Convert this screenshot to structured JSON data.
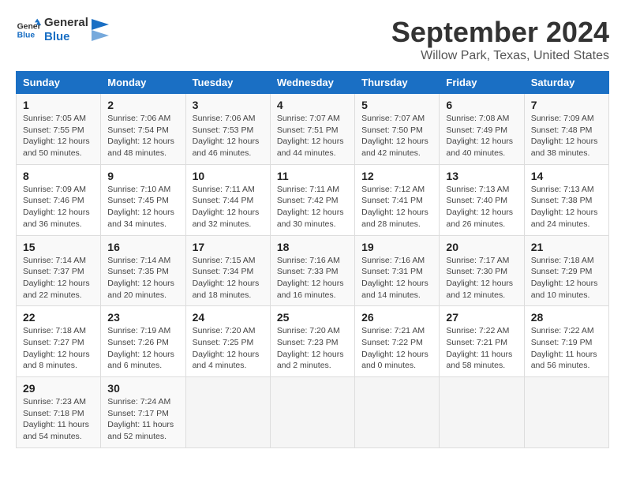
{
  "logo": {
    "line1": "General",
    "line2": "Blue"
  },
  "title": "September 2024",
  "subtitle": "Willow Park, Texas, United States",
  "headers": [
    "Sunday",
    "Monday",
    "Tuesday",
    "Wednesday",
    "Thursday",
    "Friday",
    "Saturday"
  ],
  "weeks": [
    [
      {
        "day": "1",
        "sunrise": "Sunrise: 7:05 AM",
        "sunset": "Sunset: 7:55 PM",
        "daylight": "Daylight: 12 hours and 50 minutes."
      },
      {
        "day": "2",
        "sunrise": "Sunrise: 7:06 AM",
        "sunset": "Sunset: 7:54 PM",
        "daylight": "Daylight: 12 hours and 48 minutes."
      },
      {
        "day": "3",
        "sunrise": "Sunrise: 7:06 AM",
        "sunset": "Sunset: 7:53 PM",
        "daylight": "Daylight: 12 hours and 46 minutes."
      },
      {
        "day": "4",
        "sunrise": "Sunrise: 7:07 AM",
        "sunset": "Sunset: 7:51 PM",
        "daylight": "Daylight: 12 hours and 44 minutes."
      },
      {
        "day": "5",
        "sunrise": "Sunrise: 7:07 AM",
        "sunset": "Sunset: 7:50 PM",
        "daylight": "Daylight: 12 hours and 42 minutes."
      },
      {
        "day": "6",
        "sunrise": "Sunrise: 7:08 AM",
        "sunset": "Sunset: 7:49 PM",
        "daylight": "Daylight: 12 hours and 40 minutes."
      },
      {
        "day": "7",
        "sunrise": "Sunrise: 7:09 AM",
        "sunset": "Sunset: 7:48 PM",
        "daylight": "Daylight: 12 hours and 38 minutes."
      }
    ],
    [
      {
        "day": "8",
        "sunrise": "Sunrise: 7:09 AM",
        "sunset": "Sunset: 7:46 PM",
        "daylight": "Daylight: 12 hours and 36 minutes."
      },
      {
        "day": "9",
        "sunrise": "Sunrise: 7:10 AM",
        "sunset": "Sunset: 7:45 PM",
        "daylight": "Daylight: 12 hours and 34 minutes."
      },
      {
        "day": "10",
        "sunrise": "Sunrise: 7:11 AM",
        "sunset": "Sunset: 7:44 PM",
        "daylight": "Daylight: 12 hours and 32 minutes."
      },
      {
        "day": "11",
        "sunrise": "Sunrise: 7:11 AM",
        "sunset": "Sunset: 7:42 PM",
        "daylight": "Daylight: 12 hours and 30 minutes."
      },
      {
        "day": "12",
        "sunrise": "Sunrise: 7:12 AM",
        "sunset": "Sunset: 7:41 PM",
        "daylight": "Daylight: 12 hours and 28 minutes."
      },
      {
        "day": "13",
        "sunrise": "Sunrise: 7:13 AM",
        "sunset": "Sunset: 7:40 PM",
        "daylight": "Daylight: 12 hours and 26 minutes."
      },
      {
        "day": "14",
        "sunrise": "Sunrise: 7:13 AM",
        "sunset": "Sunset: 7:38 PM",
        "daylight": "Daylight: 12 hours and 24 minutes."
      }
    ],
    [
      {
        "day": "15",
        "sunrise": "Sunrise: 7:14 AM",
        "sunset": "Sunset: 7:37 PM",
        "daylight": "Daylight: 12 hours and 22 minutes."
      },
      {
        "day": "16",
        "sunrise": "Sunrise: 7:14 AM",
        "sunset": "Sunset: 7:35 PM",
        "daylight": "Daylight: 12 hours and 20 minutes."
      },
      {
        "day": "17",
        "sunrise": "Sunrise: 7:15 AM",
        "sunset": "Sunset: 7:34 PM",
        "daylight": "Daylight: 12 hours and 18 minutes."
      },
      {
        "day": "18",
        "sunrise": "Sunrise: 7:16 AM",
        "sunset": "Sunset: 7:33 PM",
        "daylight": "Daylight: 12 hours and 16 minutes."
      },
      {
        "day": "19",
        "sunrise": "Sunrise: 7:16 AM",
        "sunset": "Sunset: 7:31 PM",
        "daylight": "Daylight: 12 hours and 14 minutes."
      },
      {
        "day": "20",
        "sunrise": "Sunrise: 7:17 AM",
        "sunset": "Sunset: 7:30 PM",
        "daylight": "Daylight: 12 hours and 12 minutes."
      },
      {
        "day": "21",
        "sunrise": "Sunrise: 7:18 AM",
        "sunset": "Sunset: 7:29 PM",
        "daylight": "Daylight: 12 hours and 10 minutes."
      }
    ],
    [
      {
        "day": "22",
        "sunrise": "Sunrise: 7:18 AM",
        "sunset": "Sunset: 7:27 PM",
        "daylight": "Daylight: 12 hours and 8 minutes."
      },
      {
        "day": "23",
        "sunrise": "Sunrise: 7:19 AM",
        "sunset": "Sunset: 7:26 PM",
        "daylight": "Daylight: 12 hours and 6 minutes."
      },
      {
        "day": "24",
        "sunrise": "Sunrise: 7:20 AM",
        "sunset": "Sunset: 7:25 PM",
        "daylight": "Daylight: 12 hours and 4 minutes."
      },
      {
        "day": "25",
        "sunrise": "Sunrise: 7:20 AM",
        "sunset": "Sunset: 7:23 PM",
        "daylight": "Daylight: 12 hours and 2 minutes."
      },
      {
        "day": "26",
        "sunrise": "Sunrise: 7:21 AM",
        "sunset": "Sunset: 7:22 PM",
        "daylight": "Daylight: 12 hours and 0 minutes."
      },
      {
        "day": "27",
        "sunrise": "Sunrise: 7:22 AM",
        "sunset": "Sunset: 7:21 PM",
        "daylight": "Daylight: 11 hours and 58 minutes."
      },
      {
        "day": "28",
        "sunrise": "Sunrise: 7:22 AM",
        "sunset": "Sunset: 7:19 PM",
        "daylight": "Daylight: 11 hours and 56 minutes."
      }
    ],
    [
      {
        "day": "29",
        "sunrise": "Sunrise: 7:23 AM",
        "sunset": "Sunset: 7:18 PM",
        "daylight": "Daylight: 11 hours and 54 minutes."
      },
      {
        "day": "30",
        "sunrise": "Sunrise: 7:24 AM",
        "sunset": "Sunset: 7:17 PM",
        "daylight": "Daylight: 11 hours and 52 minutes."
      },
      null,
      null,
      null,
      null,
      null
    ]
  ]
}
